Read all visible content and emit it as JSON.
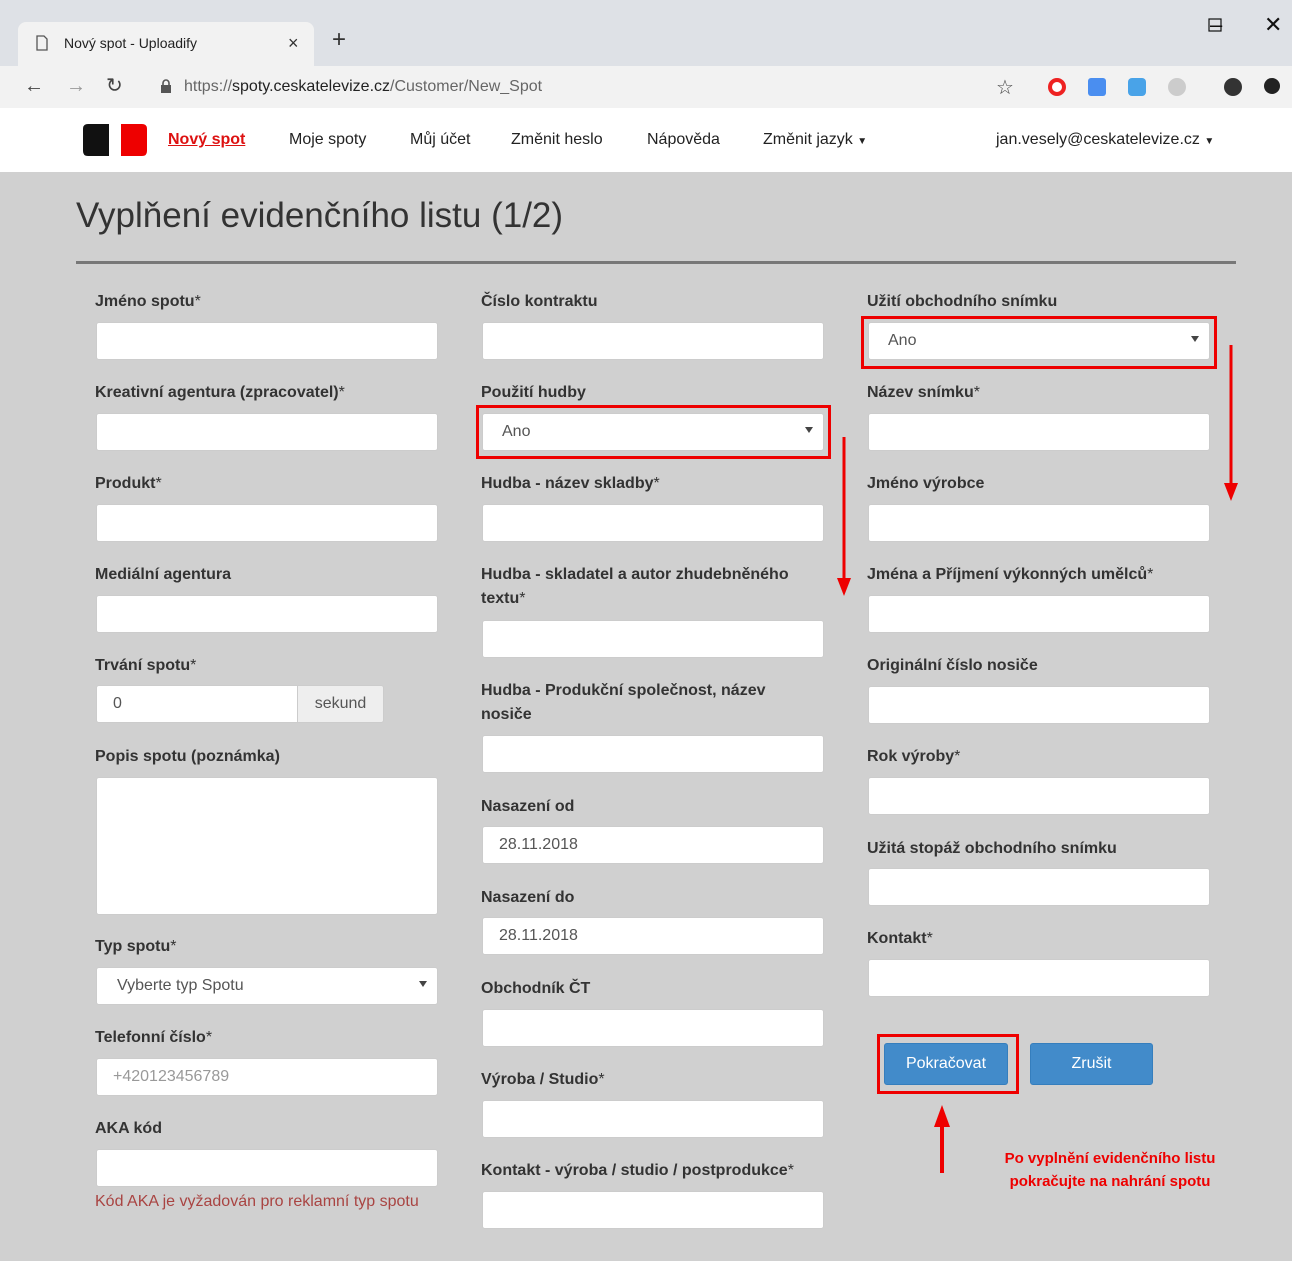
{
  "browser": {
    "tab_title": "Nový spot - Uploadify",
    "url_scheme": "https://",
    "url_host": "spoty.ceskatelevize.cz",
    "url_path": "/Customer/New_Spot"
  },
  "nav": {
    "items": [
      {
        "label": "Nový spot",
        "active": true
      },
      {
        "label": "Moje spoty"
      },
      {
        "label": "Můj účet"
      },
      {
        "label": "Změnit heslo"
      },
      {
        "label": "Nápověda"
      },
      {
        "label": "Změnit jazyk"
      }
    ],
    "user": "jan.vesely@ceskatelevize.cz"
  },
  "page": {
    "title": "Vyplňení evidenčního listu (1/2)"
  },
  "col1": {
    "jmeno_spotu": "Jméno spotu",
    "kreativni_agentura": "Kreativní agentura (zpracovatel)",
    "produkt": "Produkt",
    "medialni_agentura": "Mediální agentura",
    "trvani_spotu": "Trvání spotu",
    "trvani_value": "0",
    "trvani_unit": "sekund",
    "popis_spotu": "Popis spotu (poznámka)",
    "typ_spotu": "Typ spotu",
    "typ_spotu_value": "Vyberte typ Spotu",
    "telefon": "Telefonní číslo",
    "telefon_placeholder": "+420123456789",
    "aka_kod": "AKA kód",
    "aka_hint": "Kód AKA je vyžadován pro reklamní typ spotu"
  },
  "col2": {
    "cislo_kontraktu": "Číslo kontraktu",
    "pouziti_hudby": "Použití hudby",
    "pouziti_hudby_value": "Ano",
    "hudba_nazev": "Hudba - název skladby",
    "hudba_skladatel": "Hudba - skladatel a autor zhudebněného textu",
    "hudba_produkcni": "Hudba - Produkční společnost, název nosiče",
    "nasazeni_od": "Nasazení od",
    "nasazeni_od_value": "28.11.2018",
    "nasazeni_do": "Nasazení do",
    "nasazeni_do_value": "28.11.2018",
    "obchodnik": "Obchodník ČT",
    "vyroba_studio": "Výroba / Studio",
    "kontakt_vyroba": "Kontakt - výroba / studio / postprodukce"
  },
  "col3": {
    "uziti_snimku": "Užití obchodního snímku",
    "uziti_snimku_value": "Ano",
    "nazev_snimku": "Název snímku",
    "jmeno_vyrobce": "Jméno výrobce",
    "jmena_umelcu": "Jména a Příjmení výkonných umělců",
    "originalni_cislo": "Originální číslo nosiče",
    "rok_vyroby": "Rok výroby",
    "uzita_stopaz": "Užitá stopáž obchodního snímku",
    "kontakt": "Kontakt"
  },
  "buttons": {
    "continue": "Pokračovat",
    "cancel": "Zrušit"
  },
  "annotation": {
    "line1": "Po vyplnění evidenčního listu",
    "line2": "pokračujte na nahrání spotu"
  },
  "colors": {
    "highlight": "#e00000",
    "primary_button": "#428bca",
    "active_nav": "#dd1111"
  }
}
